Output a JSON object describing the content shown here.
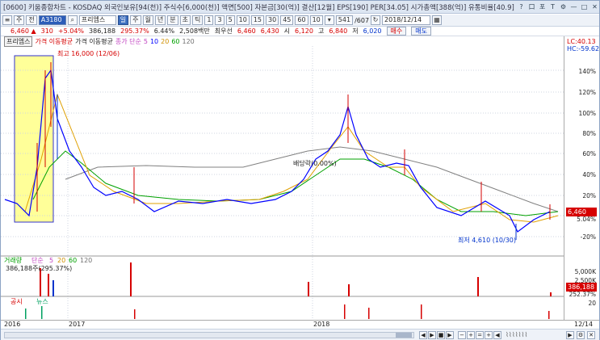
{
  "window": {
    "title": "[0600] 키움종합차트 - KOSDAQ 외국인보유[94(천)] 주식수[6,000(천)] 액면[500] 자본금[30(억)] 결산[12월] EPS[190] PER[34.05] 시가총액[388(억)] 유통비율[40.9]",
    "controls": [
      "?",
      "口",
      "포",
      "T",
      "⚙",
      "—",
      "□",
      "✕"
    ]
  },
  "toolbar": {
    "mode_main": "주",
    "mode_all": "전",
    "code": "A3180",
    "name": "프리엠스",
    "period_selected": "일",
    "periods": [
      "주",
      "월",
      "년",
      "분",
      "초",
      "틱"
    ],
    "intervals": [
      "1",
      "3",
      "5",
      "10",
      "15",
      "30",
      "45",
      "60"
    ],
    "count": "10",
    "range": "541",
    "total": "/607",
    "date": "2018/12/14"
  },
  "quote": {
    "price": "6,460 ▲",
    "change": "310",
    "change_pct": "+5.04%",
    "volume": "386,188",
    "volume_pct": "295.37%",
    "turnover": "6.44%",
    "amount": "2,508백만",
    "low_label": "최우선",
    "bid": "6,460",
    "ask": "6,430",
    "open_label": "시",
    "open": "6,120",
    "high_label": "고",
    "high": "6,840",
    "low_label2": "저",
    "low": "6,020",
    "buy_label": "매수",
    "sell_label": "매도"
  },
  "legend": {
    "name": "프리엠스",
    "ma_title": "가격 이동평균",
    "ma_title2": "가격 이동평균",
    "ma_type": "종가 단순",
    "ma": [
      "5",
      "10",
      "20",
      "60",
      "120"
    ]
  },
  "annotations": {
    "high": "최고 16,000 (12/06)",
    "low": "최저 4,610 (10/30)",
    "mid": "배당락(0.00%)"
  },
  "yaxis": {
    "lc": "LC:40.13",
    "hc": "HC:-59.62",
    "ticks": [
      "140%",
      "120%",
      "100%",
      "80%",
      "60%",
      "40%",
      "20%",
      "",
      "-20%"
    ],
    "price_box": "6,460",
    "pct": "5.04%",
    "vol_ticks": [
      "5,000K",
      "2,500K"
    ],
    "vol_box": "386,188",
    "vol_pct": "252.37%",
    "ann_tick": "20"
  },
  "volume_panel": {
    "title": "거래량",
    "ma_type": "단순",
    "ma": [
      "5",
      "20",
      "60",
      "120"
    ],
    "value": "386,188주(295.37%)"
  },
  "notice_panel": {
    "a": "공시",
    "b": "뉴스"
  },
  "xaxis": {
    "labels": [
      "2016",
      "2017",
      "2018",
      "12/14"
    ]
  },
  "colors": {
    "up": "#d60000",
    "down": "#0033cc",
    "ma5": "#e040e0",
    "ma10": "#0000ff",
    "ma20": "#e0a000",
    "ma60": "#00a000",
    "ma120": "#707070",
    "highlight": "#ffff99"
  }
}
